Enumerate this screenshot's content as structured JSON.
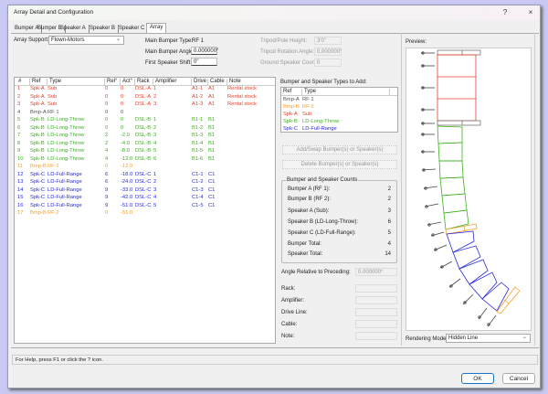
{
  "window": {
    "title": "Array Detail and Configuration",
    "help_icon": "?",
    "close_icon": "×"
  },
  "tabs": [
    "Bumper A",
    "Bumper B",
    "Speaker A",
    "Speaker B",
    "Speaker C",
    "Array"
  ],
  "active_tab": "Array",
  "array_support": {
    "label": "Array Support:",
    "value": "Flown-Motors"
  },
  "main_bumper_type": {
    "label": "Main Bumper Type:",
    "value": "RF 1"
  },
  "main_bumper_angle": {
    "label": "Main Bumper Angle:",
    "value": "0.000000°"
  },
  "first_speaker_shift": {
    "label": "First Speaker Shift:",
    "value": "0\""
  },
  "tripod_pole_height": {
    "label": "Tripod/Pole Height:",
    "value": "3'0\""
  },
  "tripod_rotation_angle": {
    "label": "Tripod Rotation Angle:",
    "value": "0.000000°"
  },
  "ground_speaker_count": {
    "label": "Ground Speaker Count:",
    "value": "0"
  },
  "colors": {
    "Bmp-A": "#555555",
    "Bmp-B": "#f5a030",
    "Spk-A": "#e8402a",
    "Spk-B": "#3cb01e",
    "Spk-C": "#2a2ae0"
  },
  "table": {
    "columns": [
      "#",
      "Ref",
      "Type",
      "Rel°",
      "Act°",
      "Rack",
      "Amplifier",
      "Drive",
      "Cable",
      "Note"
    ],
    "rows": [
      [
        "1",
        "Spk-A",
        "Sub",
        "0",
        "0",
        "DSL-A",
        "1",
        "A1-1",
        "A1",
        "Rental stock"
      ],
      [
        "2",
        "Spk-A",
        "Sub",
        "0",
        "0",
        "DSL-A",
        "2",
        "A1-2",
        "A1",
        "Rental stock"
      ],
      [
        "3",
        "Spk-A",
        "Sub",
        "0",
        "0",
        "DSL-A",
        "3",
        "A1-3",
        "A1",
        "Rental stock"
      ],
      [
        "4",
        "Bmp-A",
        "RF 1",
        "0",
        "0",
        "",
        "",
        "",
        "",
        ""
      ],
      [
        "5",
        "Spk-B",
        "LD-Long-Throw",
        "0",
        "0",
        "DSL-B",
        "1",
        "B1-1",
        "B1",
        ""
      ],
      [
        "6",
        "Spk-B",
        "LD-Long-Throw",
        "0",
        "0",
        "DSL-B",
        "2",
        "B1-2",
        "B1",
        ""
      ],
      [
        "7",
        "Spk-B",
        "LD-Long-Throw",
        "2",
        "-2.0",
        "DSL-B",
        "3",
        "B1-3",
        "B1",
        ""
      ],
      [
        "8",
        "Spk-B",
        "LD-Long-Throw",
        "2",
        "-4.0",
        "DSL-B",
        "4",
        "B1-4",
        "B1",
        ""
      ],
      [
        "9",
        "Spk-B",
        "LD-Long-Throw",
        "4",
        "-8.0",
        "DSL-B",
        "5",
        "B1-5",
        "B1",
        ""
      ],
      [
        "10",
        "Spk-B",
        "LD-Long-Throw",
        "4",
        "-12.0",
        "DSL-B",
        "6",
        "B1-6",
        "B1",
        ""
      ],
      [
        "11",
        "Bmp-B",
        "RF 2",
        "0",
        "-12.0",
        "",
        "",
        "",
        "",
        ""
      ],
      [
        "12",
        "Spk-C",
        "LD-Full-Range",
        "6",
        "-18.0",
        "DSL-C",
        "1",
        "C1-1",
        "C1",
        ""
      ],
      [
        "13",
        "Spk-C",
        "LD-Full-Range",
        "6",
        "-24.0",
        "DSL-C",
        "2",
        "C1-2",
        "C1",
        ""
      ],
      [
        "14",
        "Spk-C",
        "LD-Full-Range",
        "9",
        "-33.0",
        "DSL-C",
        "3",
        "C1-3",
        "C1",
        ""
      ],
      [
        "15",
        "Spk-C",
        "LD-Full-Range",
        "9",
        "-42.0",
        "DSL-C",
        "4",
        "C1-4",
        "C1",
        ""
      ],
      [
        "16",
        "Spk-C",
        "LD-Full-Range",
        "9",
        "-51.0",
        "DSL-C",
        "5",
        "C1-5",
        "C1",
        ""
      ],
      [
        "17",
        "Bmp-B",
        "RF 2",
        "0",
        "-51.0",
        "",
        "",
        "",
        "",
        ""
      ]
    ]
  },
  "types_to_add": {
    "label": "Bumper and Speaker Types to Add:",
    "columns": [
      "Ref",
      "Type"
    ],
    "rows": [
      [
        "Bmp-A",
        "RF 1"
      ],
      [
        "Bmp-B",
        "RF 2"
      ],
      [
        "Spk-A",
        "Sub"
      ],
      [
        "Spk-B",
        "LD-Long-Throw"
      ],
      [
        "Spk-C",
        "LD-Full-Range"
      ]
    ]
  },
  "buttons": {
    "add_swap": "Add/Swap Bumper(s) or Speaker(s)",
    "delete": "Delete Bumper(s) or Speaker(s)",
    "ok": "OK",
    "cancel": "Cancel"
  },
  "counts": {
    "title": "Bumper and Speaker Counts",
    "rows": [
      [
        "Bumper A (RF 1):",
        "2"
      ],
      [
        "Bumper B (RF 2):",
        "2"
      ],
      [
        "Speaker A (Sub):",
        "3"
      ],
      [
        "Speaker B (LD-Long-Throw):",
        "6"
      ],
      [
        "Speaker C (LD-Full-Range):",
        "5"
      ],
      [
        "Bumper Total:",
        "4"
      ],
      [
        "Speaker Total:",
        "14"
      ]
    ]
  },
  "angle_relative": {
    "label": "Angle Relative to Preceding:",
    "value": "0.000000°"
  },
  "detail_fields": {
    "rack": "Rack:",
    "amplifier": "Amplifier:",
    "drive_line": "Drive Line:",
    "cable": "Cable:",
    "note": "Note:"
  },
  "preview": {
    "label": "Preview:"
  },
  "rendering_mode": {
    "label": "Rendering Mode:",
    "value": "Hidden Line"
  },
  "status": "For Help, press F1 or click the ? icon."
}
